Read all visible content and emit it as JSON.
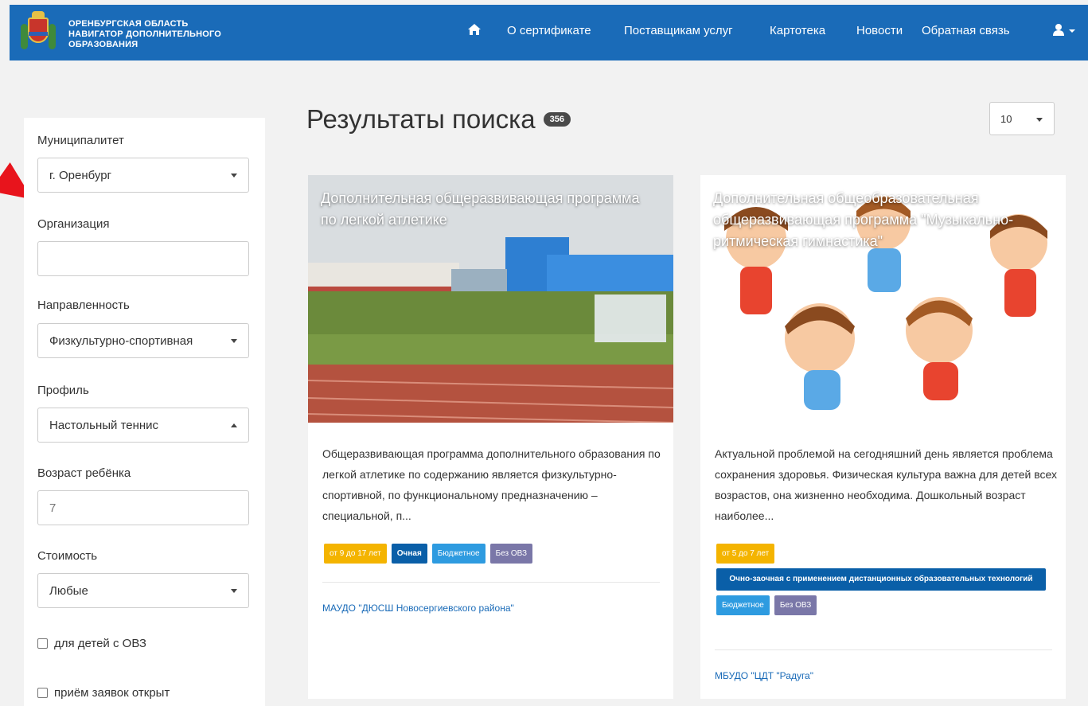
{
  "header": {
    "brand_line1": "ОРЕНБУРГСКАЯ ОБЛАСТЬ",
    "brand_line2": "НАВИГАТОР ДОПОЛНИТЕЛЬНОГО",
    "brand_line3": "ОБРАЗОВАНИЯ",
    "nav": [
      "О сертификате",
      "Поставщикам услуг",
      "Картотека",
      "Новости",
      "Обратная связь"
    ],
    "bg_color": "#1a6bb8"
  },
  "filters": {
    "municipality_label": "Муниципалитет",
    "municipality_value": "г. Оренбург",
    "organization_label": "Организация",
    "organization_value": "",
    "direction_label": "Направленность",
    "direction_value": "Физкультурно-спортивная",
    "profile_label": "Профиль",
    "profile_value": "Настольный теннис",
    "age_label": "Возраст ребёнка",
    "age_value": "7",
    "cost_label": "Стоимость",
    "cost_value": "Любые",
    "ovz_checkbox": "для детей с ОВЗ",
    "open_checkbox": "приём заявок открыт"
  },
  "results": {
    "title": "Результаты поиска",
    "count": "356",
    "page_size": "10"
  },
  "cards": [
    {
      "title": "Дополнительная общеразвивающая программа по легкой атлетике",
      "description": "Общеразвивающая программа дополнительного образования по легкой атлетике по содержанию является физкультурно-спортивной, по функциональному предназначению – специальной, п...",
      "tags": [
        "от 9 до 17 лет",
        "Очная",
        "Бюджетное",
        "Без ОВЗ"
      ],
      "organization": "МАУДО \"ДЮСШ Новосергиевского района\""
    },
    {
      "title": "Дополнительная общеобразовательная общеразвивающая программа \"Музыкально-ритмическая гимнастика\"",
      "description": "Актуальной проблемой на сегодняшний день является проблема сохранения здоровья. Физическая культура важна для детей всех возрастов, она жизненно необходима. Дошкольный возраст наиболее...",
      "tags": [
        "от 5 до 7 лет",
        "Очно-заочная с применением дистанционных образовательных технологий",
        "Бюджетное",
        "Без ОВЗ"
      ],
      "organization": "МБУДО \"ЦДТ \"Радуга\""
    }
  ],
  "icons": {
    "home": "home-icon",
    "user": "user-icon",
    "arrow": "red-arrow"
  },
  "colors": {
    "accent": "#1a6bb8",
    "age_tag": "#f4b400",
    "form_tag": "#0a5fa8",
    "budget_tag": "#2e9be0",
    "ovz_tag": "#7a77a8",
    "arrow": "#e8141c"
  }
}
